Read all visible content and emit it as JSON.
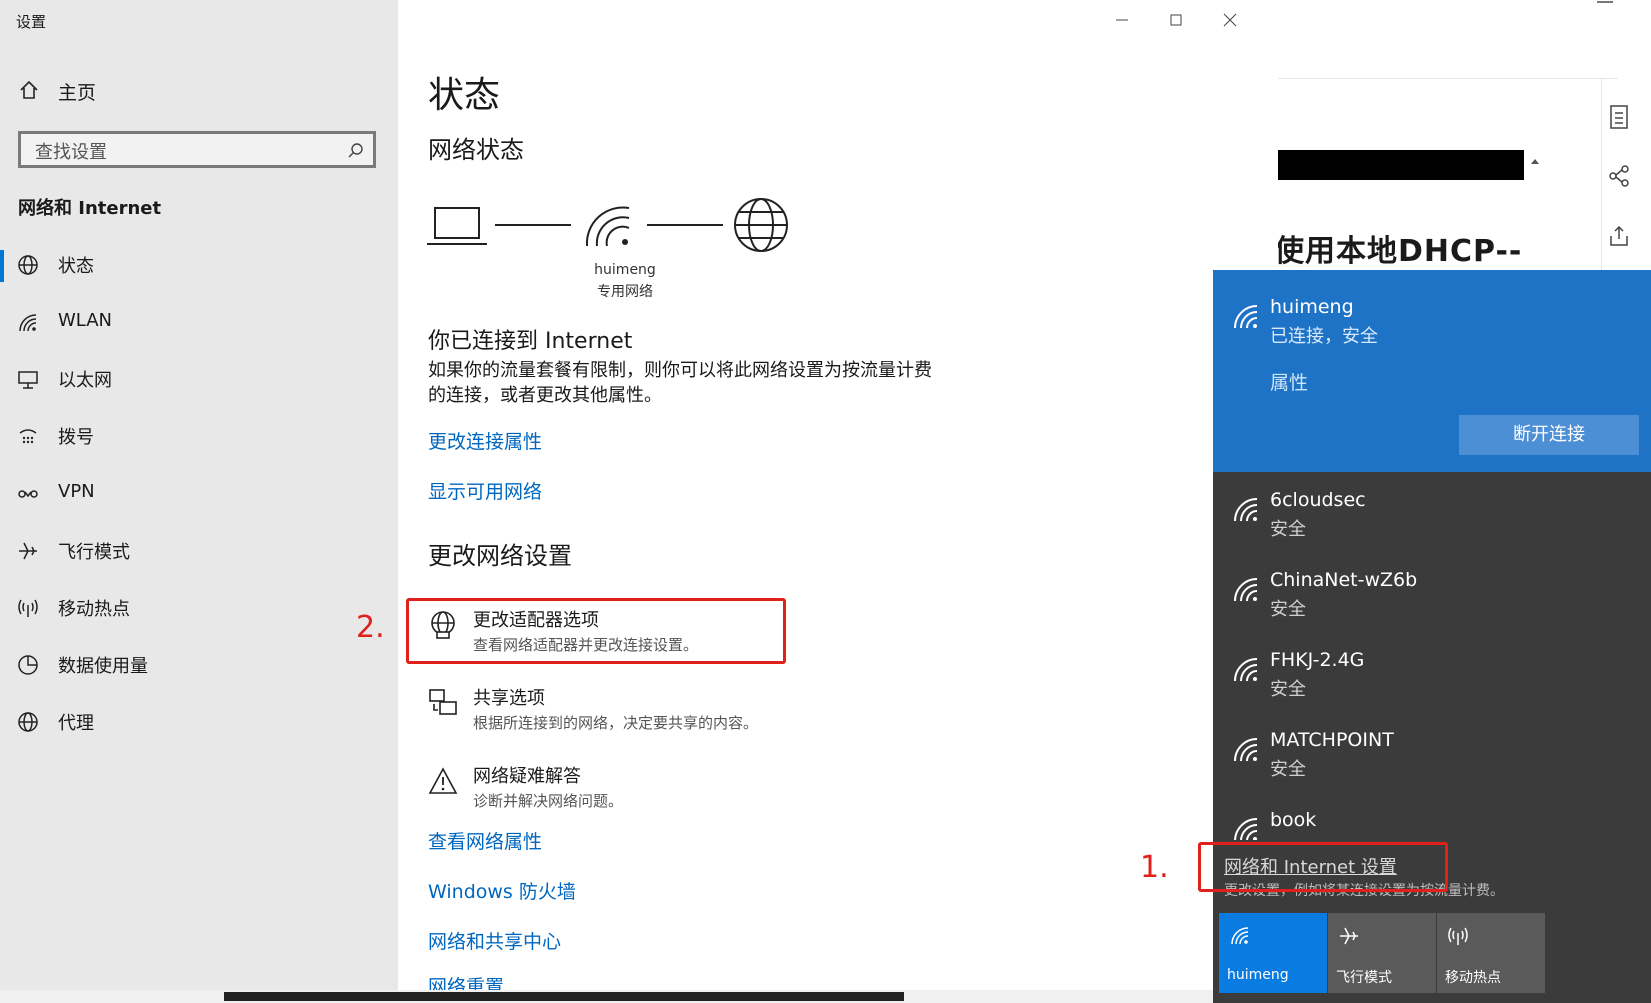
{
  "app_title": "设置",
  "sidebar": {
    "home": "主页",
    "search_placeholder": "查找设置",
    "section": "网络和 Internet",
    "items": [
      {
        "label": "状态",
        "icon": "globe-icon"
      },
      {
        "label": "WLAN",
        "icon": "wifi-icon"
      },
      {
        "label": "以太网",
        "icon": "ethernet-icon"
      },
      {
        "label": "拨号",
        "icon": "dialup-icon"
      },
      {
        "label": "VPN",
        "icon": "vpn-icon"
      },
      {
        "label": "飞行模式",
        "icon": "airplane-icon"
      },
      {
        "label": "移动热点",
        "icon": "hotspot-icon"
      },
      {
        "label": "数据使用量",
        "icon": "data-usage-icon"
      },
      {
        "label": "代理",
        "icon": "proxy-icon"
      }
    ]
  },
  "main": {
    "title": "状态",
    "network_status": "网络状态",
    "network_name": "huimeng",
    "network_type": "专用网络",
    "connected_title": "你已连接到 Internet",
    "connected_desc": "如果你的流量套餐有限制，则你可以将此网络设置为按流量计费的连接，或者更改其他属性。",
    "link_change_props": "更改连接属性",
    "link_show_networks": "显示可用网络",
    "change_settings": "更改网络设置",
    "options": [
      {
        "title": "更改适配器选项",
        "desc": "查看网络适配器并更改连接设置。"
      },
      {
        "title": "共享选项",
        "desc": "根据所连接到的网络，决定要共享的内容。"
      },
      {
        "title": "网络疑难解答",
        "desc": "诊断并解决网络问题。"
      }
    ],
    "link_view_props": "查看网络属性",
    "link_firewall": "Windows 防火墙",
    "link_sharing_center": "网络和共享中心",
    "link_reset": "网络重置",
    "annotation_2": "2.",
    "annotation_1": "1."
  },
  "background": {
    "heading": "使用本地DHCP--"
  },
  "flyout": {
    "active": {
      "name": "huimeng",
      "status": "已连接，安全",
      "properties": "属性",
      "disconnect": "断开连接"
    },
    "networks": [
      {
        "name": "6cloudsec",
        "sub": "安全"
      },
      {
        "name": "ChinaNet-wZ6b",
        "sub": "安全"
      },
      {
        "name": "FHKJ-2.4G",
        "sub": "安全"
      },
      {
        "name": "MATCHPOINT",
        "sub": "安全"
      },
      {
        "name": "book",
        "sub": ""
      }
    ],
    "settings_link": "网络和 Internet 设置",
    "settings_desc": "更改设置，例如将某连接设置为按流量计费。",
    "quick": [
      {
        "label": "huimeng",
        "icon": "wifi-icon"
      },
      {
        "label": "飞行模式",
        "icon": "airplane-icon"
      },
      {
        "label": "移动热点",
        "icon": "hotspot-icon"
      }
    ]
  },
  "colors": {
    "accent": "#0078d7",
    "link": "#0067c0",
    "annotation": "#e0201a",
    "flyout_active": "#1e73c7"
  }
}
